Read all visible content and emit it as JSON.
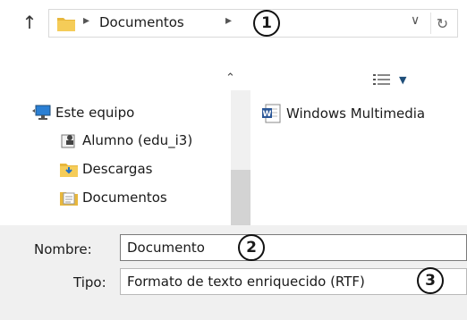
{
  "address_bar": {
    "path": "Documentos",
    "callout": "1"
  },
  "nav": {
    "items": [
      {
        "label": "Este equipo",
        "icon": "computer-icon"
      },
      {
        "label": "Alumno (edu_i3)",
        "icon": "user-folder-icon"
      },
      {
        "label": "Descargas",
        "icon": "downloads-folder-icon"
      },
      {
        "label": "Documentos",
        "icon": "documents-folder-icon"
      }
    ]
  },
  "files": {
    "items": [
      {
        "name": "Windows Multimedia",
        "icon": "word-document-icon"
      }
    ]
  },
  "form": {
    "name_label": "Nombre:",
    "name_value": "Documento",
    "name_callout": "2",
    "type_label": "Tipo:",
    "type_value": "Formato de texto enriquecido (RTF)",
    "type_callout": "3"
  },
  "colors": {
    "folder_yellow": "#e8b73c",
    "accent_blue": "#1f4e79",
    "window_bg": "#f0f0f0"
  }
}
